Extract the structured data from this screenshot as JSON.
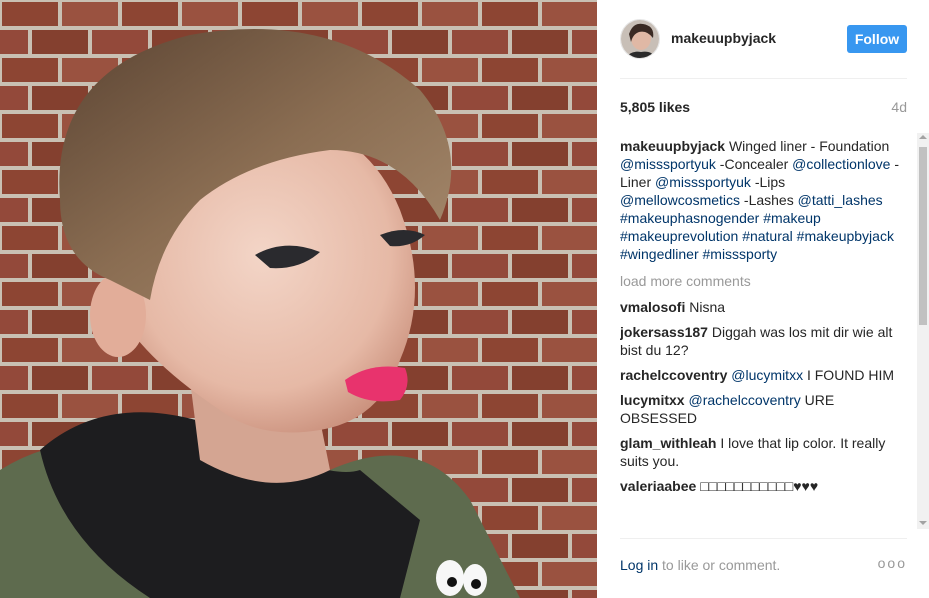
{
  "post": {
    "username": "makeuupbyjack",
    "follow_label": "Follow",
    "likes": "5,805 likes",
    "time_ago": "4d"
  },
  "caption": {
    "username": "makeuupbyjack",
    "parts": [
      {
        "text": "Winged liner - Foundation ",
        "tag": false
      },
      {
        "text": "@misssportyuk",
        "tag": true
      },
      {
        "text": " -Concealer ",
        "tag": false
      },
      {
        "text": "@collectionlove",
        "tag": true
      },
      {
        "text": " -Liner ",
        "tag": false
      },
      {
        "text": "@misssportyuk",
        "tag": true
      },
      {
        "text": " -Lips ",
        "tag": false
      },
      {
        "text": "@mellowcosmetics",
        "tag": true
      },
      {
        "text": " -Lashes ",
        "tag": false
      },
      {
        "text": "@tatti_lashes",
        "tag": true
      },
      {
        "text": " ",
        "tag": false
      },
      {
        "text": "#makeuphasnogender",
        "tag": true
      },
      {
        "text": " ",
        "tag": false
      },
      {
        "text": "#makeup",
        "tag": true
      },
      {
        "text": " ",
        "tag": false
      },
      {
        "text": "#makeuprevolution",
        "tag": true
      },
      {
        "text": " ",
        "tag": false
      },
      {
        "text": "#natural",
        "tag": true
      },
      {
        "text": " ",
        "tag": false
      },
      {
        "text": "#makeupbyjack",
        "tag": true
      },
      {
        "text": " ",
        "tag": false
      },
      {
        "text": "#wingedliner",
        "tag": true
      },
      {
        "text": " ",
        "tag": false
      },
      {
        "text": "#misssporty",
        "tag": true
      }
    ]
  },
  "load_more": "load more comments",
  "comments": [
    {
      "user": "vmalosofi",
      "parts": [
        {
          "text": "Nisna",
          "tag": false
        }
      ]
    },
    {
      "user": "jokersass187",
      "parts": [
        {
          "text": "Diggah was los mit dir wie alt bist du 12?",
          "tag": false
        }
      ]
    },
    {
      "user": "rachelccoventry",
      "parts": [
        {
          "text": "@lucymitxx",
          "tag": true
        },
        {
          "text": " I FOUND HIM",
          "tag": false
        }
      ]
    },
    {
      "user": "lucymitxx",
      "parts": [
        {
          "text": "@rachelccoventry",
          "tag": true
        },
        {
          "text": " URE OBSESSED",
          "tag": false
        }
      ]
    },
    {
      "user": "glam_withleah",
      "parts": [
        {
          "text": "I love that lip color. It really suits you.",
          "tag": false
        }
      ]
    },
    {
      "user": "valeriaabee",
      "parts": [
        {
          "text": "□□□□□□□□□□□♥♥♥",
          "tag": false
        }
      ]
    }
  ],
  "footer": {
    "login": "Log in",
    "rest": " to like or comment.",
    "more": "ooo"
  },
  "colors": {
    "follow_bg": "#3897f0",
    "link": "#003569",
    "muted": "#999999"
  }
}
